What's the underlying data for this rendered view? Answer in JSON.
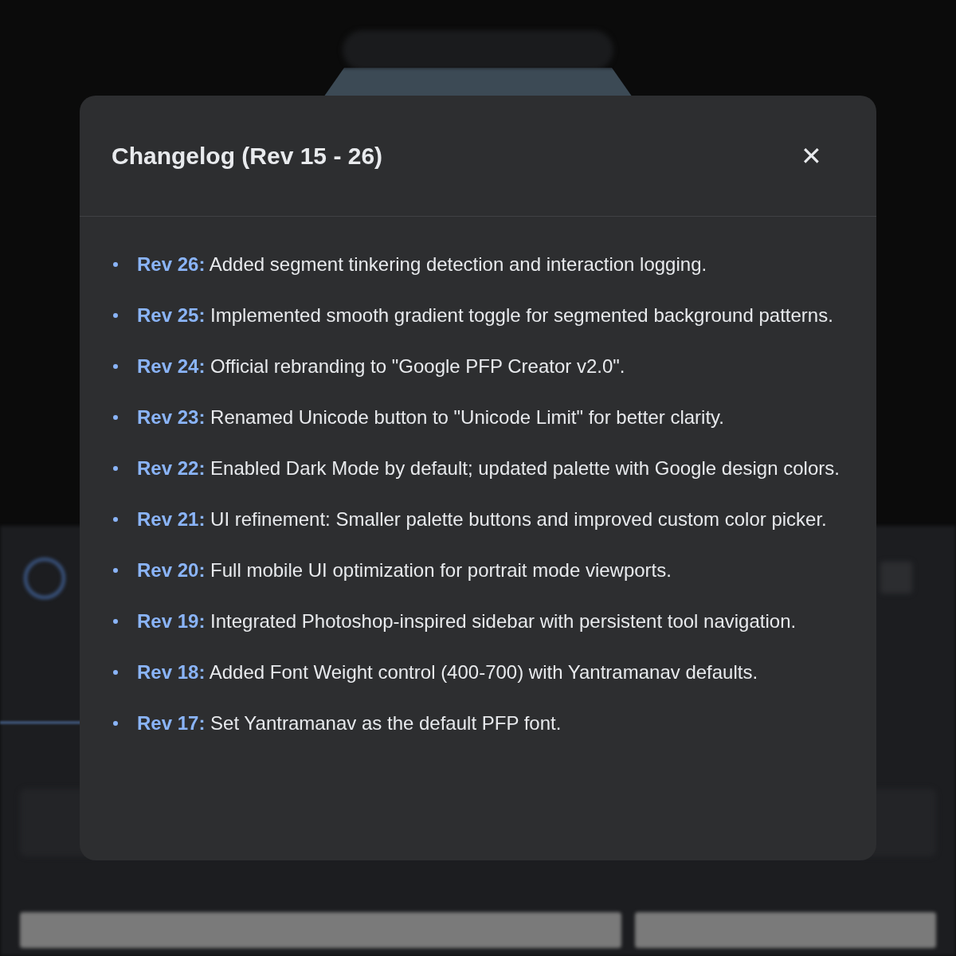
{
  "dialog": {
    "title": "Changelog (Rev 15 - 26)",
    "close_label": "✕",
    "entries": [
      {
        "rev": "Rev 26:",
        "text": "Added segment tinkering detection and interaction logging."
      },
      {
        "rev": "Rev 25:",
        "text": "Implemented smooth gradient toggle for segmented background patterns."
      },
      {
        "rev": "Rev 24:",
        "text": "Official rebranding to \"Google PFP Creator v2.0\"."
      },
      {
        "rev": "Rev 23:",
        "text": "Renamed Unicode button to \"Unicode Limit\" for better clarity."
      },
      {
        "rev": "Rev 22:",
        "text": "Enabled Dark Mode by default; updated palette with Google design colors."
      },
      {
        "rev": "Rev 21:",
        "text": "UI refinement: Smaller palette buttons and improved custom color picker."
      },
      {
        "rev": "Rev 20:",
        "text": "Full mobile UI optimization for portrait mode viewports."
      },
      {
        "rev": "Rev 19:",
        "text": "Integrated Photoshop-inspired sidebar with persistent tool navigation."
      },
      {
        "rev": "Rev 18:",
        "text": "Added Font Weight control (400-700) with Yantramanav defaults."
      },
      {
        "rev": "Rev 17:",
        "text": "Set Yantramanav as the default PFP font."
      }
    ]
  }
}
